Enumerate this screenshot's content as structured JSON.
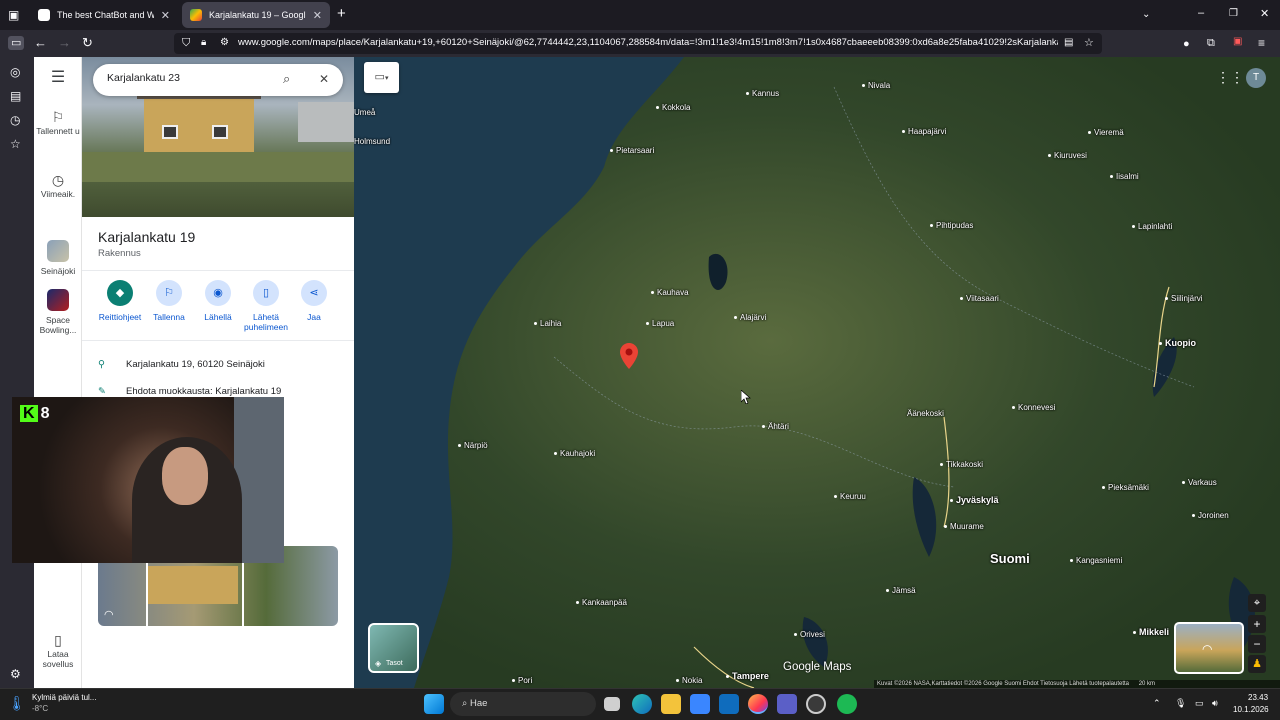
{
  "browser": {
    "tabs": [
      {
        "title": "The best ChatBot and Wid",
        "active": false
      },
      {
        "title": "Karjalankatu 19 – Google Maps",
        "active": true
      }
    ],
    "url": "www.google.com/maps/place/Karjalankatu+19,+60120+Seinäjoki/@62,7744442,23,1104067,288584m/data=!3m1!1e3!4m15!1m8!3m7!1s0x4687cbaeeeb08399:0xd6a8e25faba41029!2sKarjalankatu+23..."
  },
  "rail": {
    "saved_label": "Tallennett u",
    "recent_label": "Viimeaik.",
    "recent_place_1": "Seinäjoki",
    "recent_place_2": "Space Bowling...",
    "app_label": "Lataa sovellus"
  },
  "search": {
    "value": "Karjalankatu 23"
  },
  "place": {
    "title": "Karjalankatu 19",
    "type": "Rakennus",
    "actions": {
      "directions": "Reittiohjeet",
      "save": "Tallenna",
      "nearby": "Lähellä",
      "send": "Lähetä puhelimeen",
      "share": "Jaa"
    },
    "address": "Karjalankatu 19, 60120 Seinäjoki",
    "suggest_edit": "Ehdota muokkausta: Karjalankatu 19"
  },
  "webcam": {
    "count": "8"
  },
  "map": {
    "layers_label": "Tasot",
    "attribution": "Kuvat ©2026 NASA,Karttatiedot ©2026 Google   Suomi   Ehdot   Tietosuoja   Lähetä tuotepalautetta",
    "scale": "20 km",
    "places": {
      "nivala": "Nivala",
      "kannus": "Kannus",
      "kokkola": "Kokkola",
      "haapajarvi": "Haapajärvi",
      "vieremä": "Vieremä",
      "pietarsaari": "Pietarsaari",
      "kiuruvesi": "Kiuruvesi",
      "iisalmi": "Iisalmi",
      "holmsund": "Holmsund",
      "umea": "Umeå",
      "pihtipudas": "Pihtipudas",
      "lapinlahti": "Lapinlahti",
      "kauhava": "Kauhava",
      "viitasaari": "Viitasaari",
      "siilinjarvi": "Siilinjärvi",
      "laihia": "Laihia",
      "lapua": "Lapua",
      "alajarvi": "Alajärvi",
      "kuopio": "Kuopio",
      "aanekoski": "Äänekoski",
      "konnevesi": "Konnevesi",
      "ahtari": "Ähtäri",
      "narpio": "Närpiö",
      "kauhajoki": "Kauhajoki",
      "tikkakoski": "Tikkakoski",
      "jyvaskyla": "Jyväskylä",
      "pieksamaki": "Pieksämäki",
      "varkaus": "Varkaus",
      "keuruu": "Keuruu",
      "muurame": "Muurame",
      "joroinen": "Joroinen",
      "suomi": "Suomi",
      "kangasniemi": "Kangasniemi",
      "jamsa": "Jämsä",
      "kankaanpaa": "Kankaanpää",
      "orivesi": "Orivesi",
      "mikkeli": "Mikkeli",
      "nokia": "Nokia",
      "tampere": "Tampere",
      "pori": "Pori"
    },
    "google_logo": "Google Maps",
    "avatar_letter": "T"
  },
  "taskbar": {
    "weather_title": "Kylmiä päiviä tul...",
    "weather_temp": "-8°C",
    "search_label": "Hae",
    "time": "23.43",
    "date": "10.1.2026"
  },
  "colors": {
    "accent": "#0b7f73",
    "link": "#0b57d0",
    "pin": "#ea4335",
    "browser_bg": "#1c1b22"
  }
}
